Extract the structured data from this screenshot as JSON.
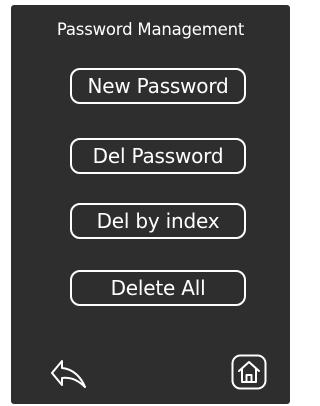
{
  "screen": {
    "title": "Password Management",
    "buttons": [
      {
        "label": "New Password"
      },
      {
        "label": "Del Password"
      },
      {
        "label": "Del by index"
      },
      {
        "label": "Delete All"
      }
    ],
    "nav": {
      "back_icon": "back-arrow-icon",
      "home_icon": "home-icon"
    },
    "colors": {
      "background": "#2e2e2e",
      "foreground": "#ffffff"
    }
  }
}
